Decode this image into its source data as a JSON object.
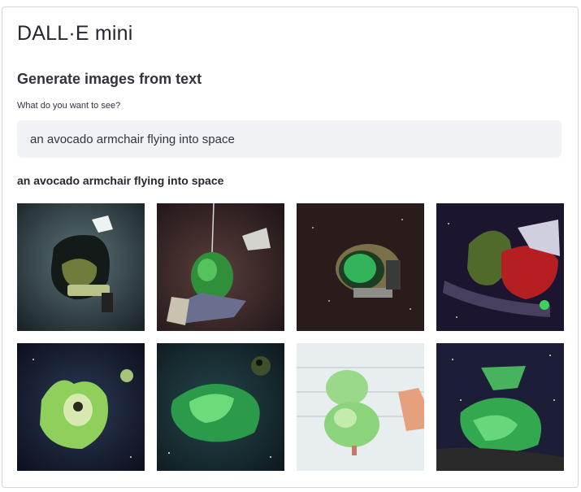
{
  "app": {
    "title": "DALL·E mini",
    "subtitle": "Generate images from text"
  },
  "prompt": {
    "label": "What do you want to see?",
    "value": "an avocado armchair flying into space"
  },
  "results": {
    "caption": "an avocado armchair flying into space",
    "images": [
      {
        "name": "generated-image-1"
      },
      {
        "name": "generated-image-2"
      },
      {
        "name": "generated-image-3"
      },
      {
        "name": "generated-image-4"
      },
      {
        "name": "generated-image-5"
      },
      {
        "name": "generated-image-6"
      },
      {
        "name": "generated-image-7"
      },
      {
        "name": "generated-image-8"
      }
    ]
  }
}
